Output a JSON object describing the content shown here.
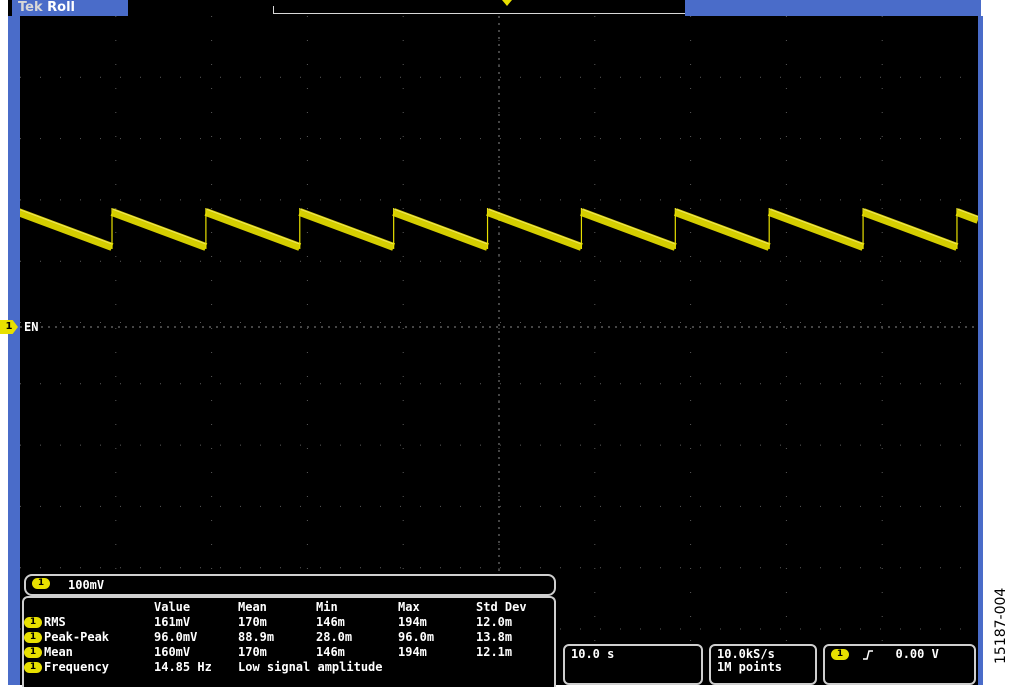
{
  "header": {
    "brand_prefix": "Tek",
    "mode": "Roll"
  },
  "channel": {
    "badge": "1",
    "name": "EN",
    "scale": "100mV",
    "trace_color": "#e8e000"
  },
  "measurements": {
    "columns": [
      "Value",
      "Mean",
      "Min",
      "Max",
      "Std Dev"
    ],
    "rows": [
      {
        "badge": "1",
        "name": "RMS",
        "value": "161mV",
        "mean": "170m",
        "min": "146m",
        "max": "194m",
        "std": "12.0m"
      },
      {
        "badge": "1",
        "name": "Peak-Peak",
        "value": "96.0mV",
        "mean": "88.9m",
        "min": "28.0m",
        "max": "96.0m",
        "std": "13.8m"
      },
      {
        "badge": "1",
        "name": "Mean",
        "value": "160mV",
        "mean": "170m",
        "min": "146m",
        "max": "194m",
        "std": "12.1m"
      },
      {
        "badge": "1",
        "name": "Frequency",
        "value": "14.85 Hz",
        "note": "Low signal amplitude"
      }
    ]
  },
  "status": {
    "timebase": "10.0 s",
    "sample_rate": "10.0kS/s",
    "record_length": "1M points",
    "trigger_source": "1",
    "trigger_slope": "rising",
    "trigger_level": "0.00 V"
  },
  "waveform": {
    "type": "sawtooth",
    "period_divisions": 0.98,
    "upper_level_divisions": 2.1,
    "lower_level_divisions": 1.4
  },
  "figure_id": "15187-004",
  "colors": {
    "accent_blue": "#4a6cc9",
    "trace_yellow": "#e8e000",
    "background": "#000000"
  }
}
